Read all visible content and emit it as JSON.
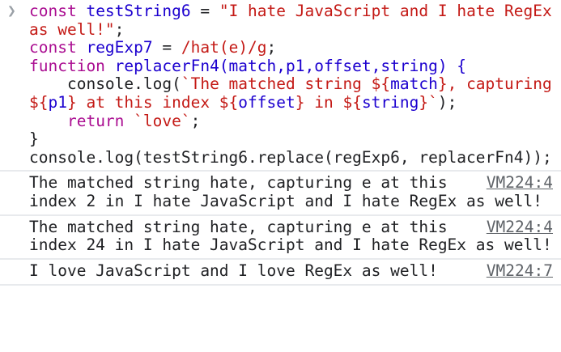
{
  "input": {
    "prompt_icon": "chevron-right-icon",
    "tokens": {
      "l1_kw": "const",
      "l1_name": "testString6",
      "l1_eq": " = ",
      "l1_str": "\"I hate JavaScript and I hate RegEx as well!\"",
      "l1_end": ";",
      "l2_kw": "const",
      "l2_name": "regExp7",
      "l2_eq": " = ",
      "l2_regex": "/hat(e)/g",
      "l2_end": ";",
      "l3_kw": "function",
      "l3_name": "replacerFn4",
      "l3_params": "(match,p1,offset,string) {",
      "l4_a": "    console.log(",
      "l4_s1": "`The matched string ${",
      "l4_v1": "match",
      "l4_s2": "}, capturing ${",
      "l4_v2": "p1",
      "l4_s3": "} at this index ${",
      "l4_v3": "offset",
      "l4_s4": "} in ${",
      "l4_v4": "string",
      "l4_s5": "}`",
      "l4_end": ");",
      "l5_kw": "    return",
      "l5_str": "`love`",
      "l5_end": ";",
      "l6": "}",
      "l7": "console.log(testString6.replace(regExp6, replacerFn4));"
    }
  },
  "logs": [
    {
      "text": "The matched string hate, capturing e at this index 2 in I hate JavaScript and I hate RegEx as well!",
      "source": "VM224:4"
    },
    {
      "text": "The matched string hate, capturing e at this index 24 in I hate JavaScript and I hate RegEx as well!",
      "source": "VM224:4"
    },
    {
      "text": "I love JavaScript and I love RegEx as well!",
      "source": "VM224:7"
    }
  ]
}
